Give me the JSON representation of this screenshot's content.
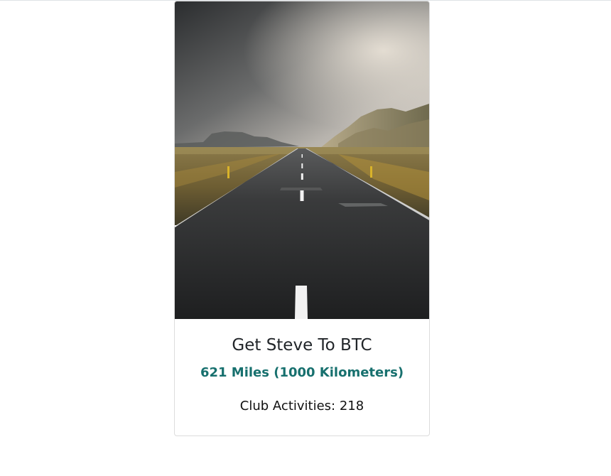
{
  "card": {
    "title": "Get Steve To BTC",
    "distance": "621 Miles (1000 Kilometers)",
    "activities": "Club Activities: 218",
    "image": "road-landscape-photo"
  },
  "colors": {
    "distance_text": "#17706e",
    "card_border": "#dcdcdc"
  }
}
